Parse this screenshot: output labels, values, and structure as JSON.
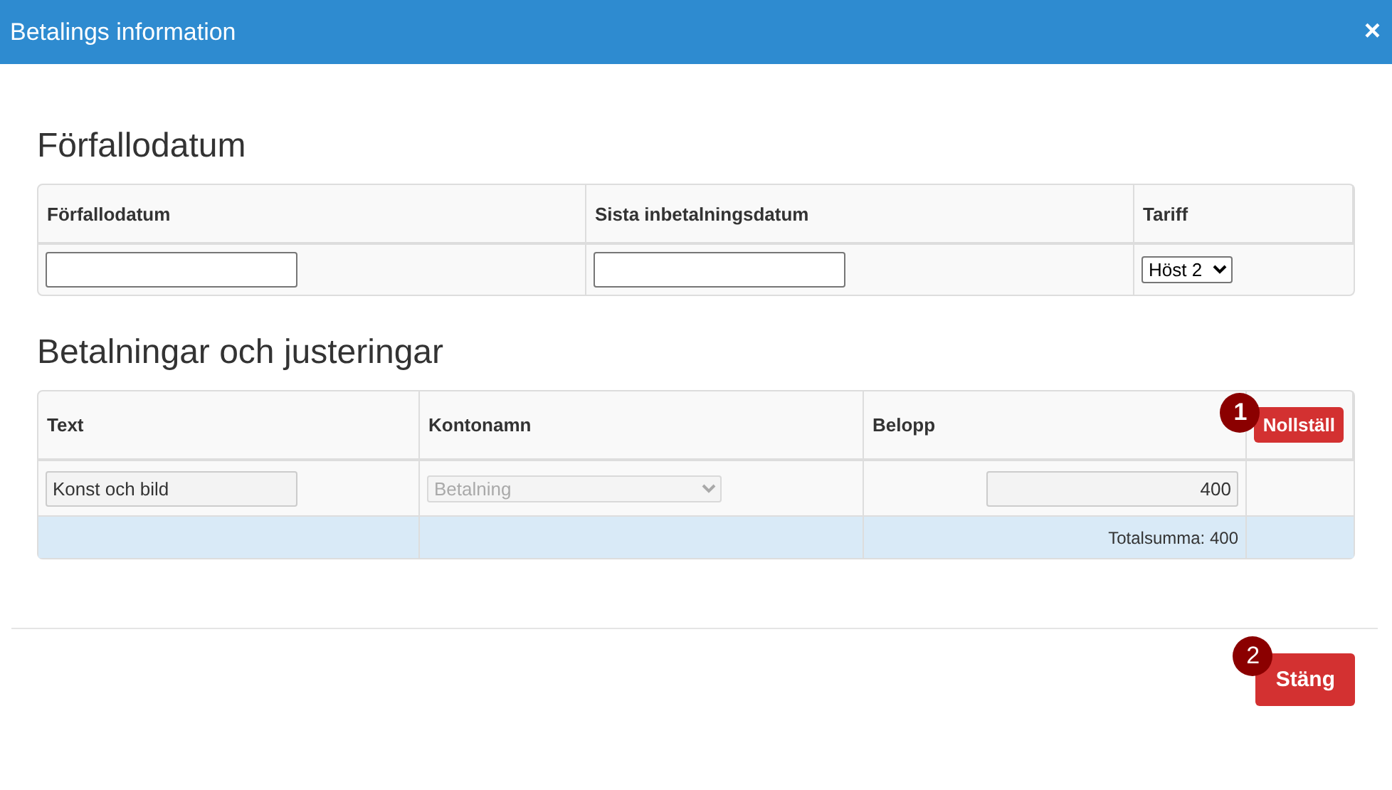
{
  "window": {
    "title": "Betalings information",
    "close": "×"
  },
  "due_section": {
    "heading": "Förfallodatum",
    "columns": [
      "Förfallodatum",
      "Sista inbetalningsdatum",
      "Tariff"
    ],
    "row": {
      "tariff": "Höst 2"
    }
  },
  "payments_section": {
    "heading": "Betalningar och justeringar",
    "columns": [
      "Text",
      "Kontonamn",
      "Belopp"
    ],
    "reset_button": {
      "label": "Nollställ",
      "badge": "1"
    },
    "rows": [
      {
        "text": "Konst och bild",
        "account": "Betalning",
        "amount": "400",
        "disabled": true
      }
    ],
    "total": "Totalsumma: 400"
  },
  "footer": {
    "close_button": {
      "label": "Stäng",
      "badge": "2"
    }
  }
}
